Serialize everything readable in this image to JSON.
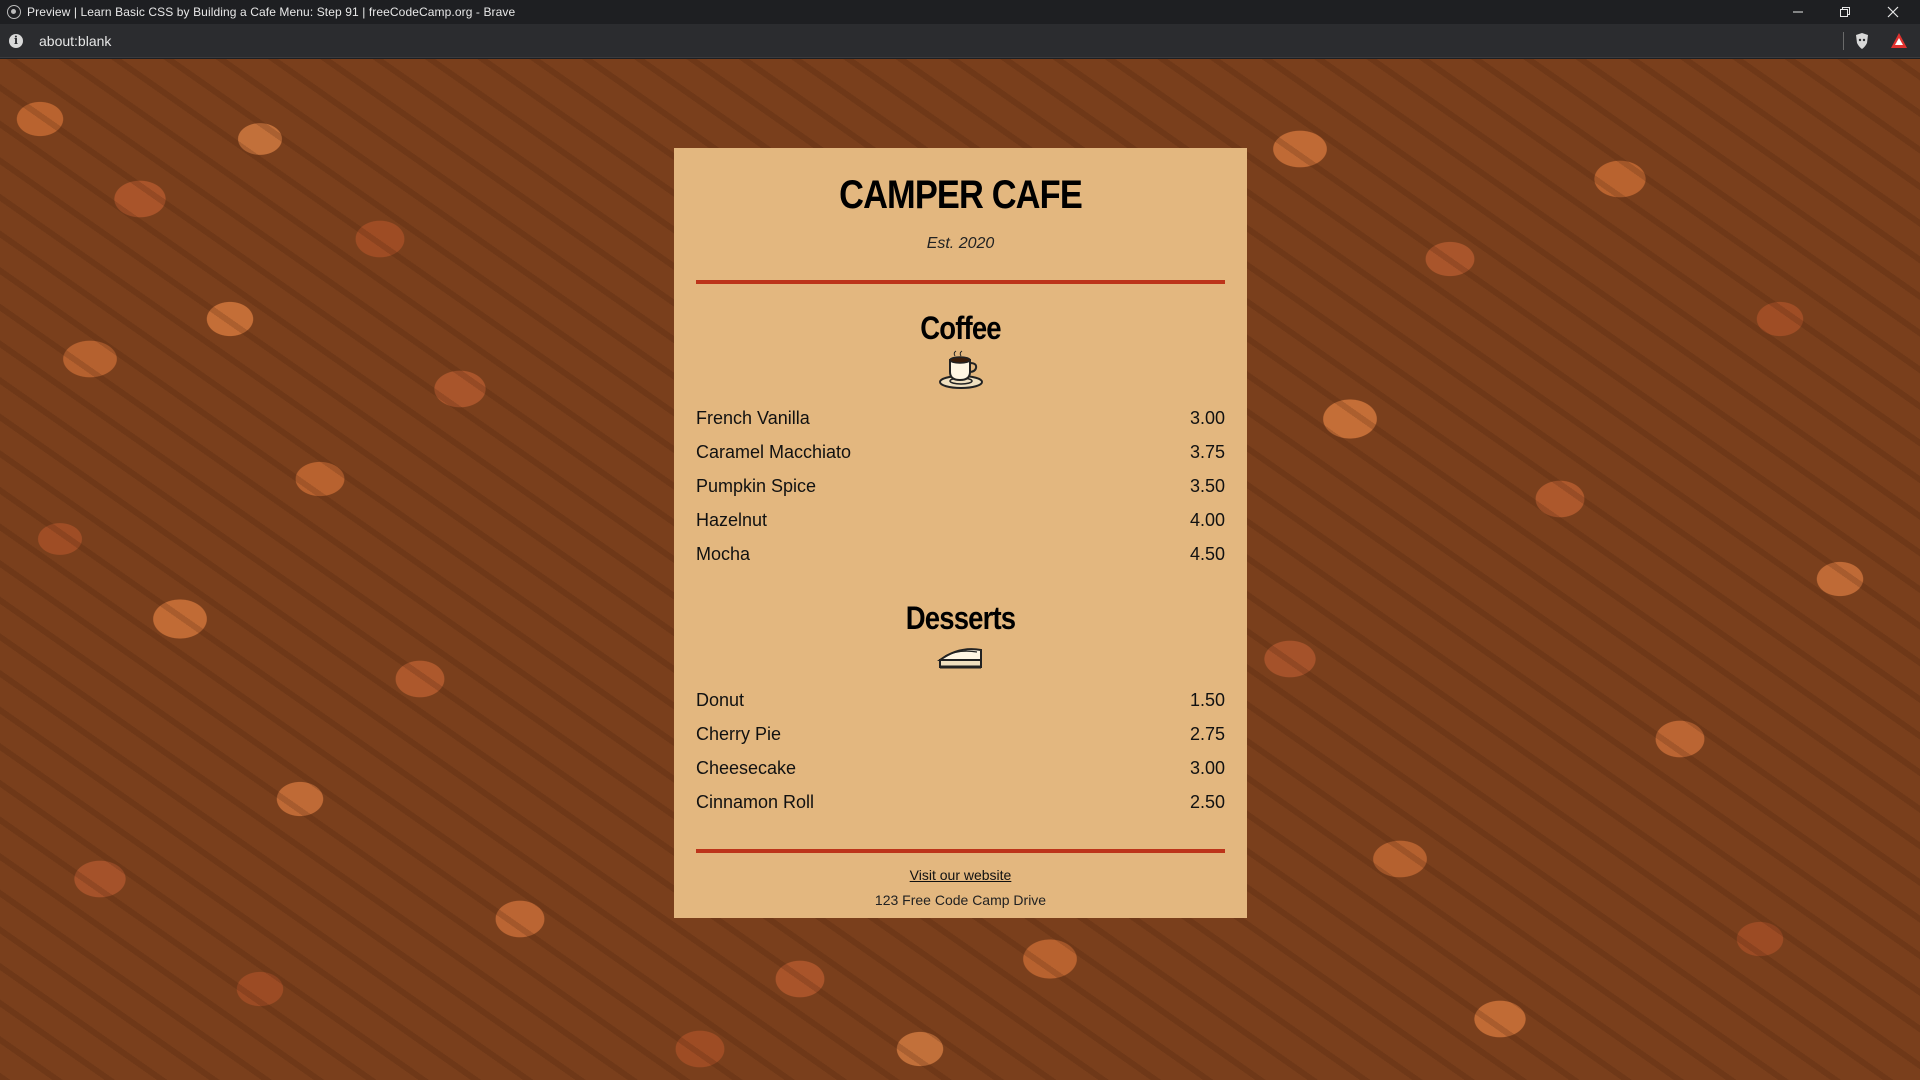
{
  "window": {
    "title": "Preview | Learn Basic CSS by Building a Cafe Menu: Step 91 | freeCodeCamp.org - Brave",
    "controls": [
      "minimize-icon",
      "maximize-icon",
      "close-icon"
    ]
  },
  "addressbar": {
    "url": "about:blank",
    "icons": [
      "info-icon",
      "brave-shields-icon",
      "brave-rewards-icon"
    ]
  },
  "menu": {
    "title": "CAMPER CAFE",
    "established": "Est. 2020",
    "accent_color": "#bd341a",
    "card_color": "#e3b77f",
    "sections": [
      {
        "heading": "Coffee",
        "icon": "coffee-cup-icon",
        "items": [
          {
            "name": "French Vanilla",
            "price": "3.00"
          },
          {
            "name": "Caramel Macchiato",
            "price": "3.75"
          },
          {
            "name": "Pumpkin Spice",
            "price": "3.50"
          },
          {
            "name": "Hazelnut",
            "price": "4.00"
          },
          {
            "name": "Mocha",
            "price": "4.50"
          }
        ]
      },
      {
        "heading": "Desserts",
        "icon": "pie-slice-icon",
        "items": [
          {
            "name": "Donut",
            "price": "1.50"
          },
          {
            "name": "Cherry Pie",
            "price": "2.75"
          },
          {
            "name": "Cheesecake",
            "price": "3.00"
          },
          {
            "name": "Cinnamon Roll",
            "price": "2.50"
          }
        ]
      }
    ],
    "footer": {
      "link_text": "Visit our website",
      "address": "123 Free Code Camp Drive"
    }
  }
}
